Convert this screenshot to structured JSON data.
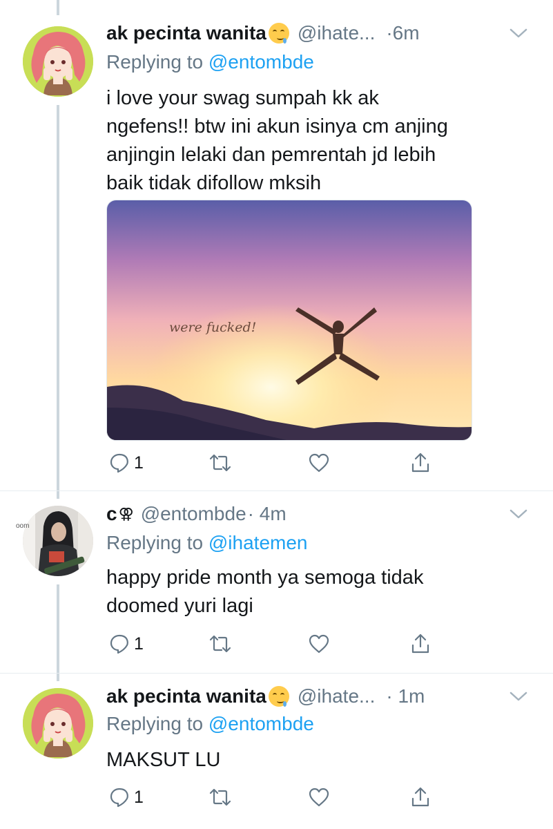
{
  "tweets": [
    {
      "name": "ak pecinta wanita",
      "handle": "@ihate...",
      "time": "·6m",
      "replying_prefix": "Replying to ",
      "replying_to": "@entombde",
      "lines": [
        "i love your swag sumpah kk ak",
        "ngefens!! btw ini akun isinya cm anjing",
        "anjingin lelaki dan pemrentah jd lebih",
        "baik tidak difollow mksih"
      ],
      "media_caption": "were fucked!",
      "reply_count": "1"
    },
    {
      "name": "c",
      "handle": "@entombde",
      "time": "· 4m",
      "replying_prefix": "Replying to ",
      "replying_to": "@ihatemen",
      "lines": [
        "happy pride month ya semoga tidak",
        "doomed yuri lagi"
      ],
      "avatar_side_text": "oom",
      "reply_count": "1"
    },
    {
      "name": "ak pecinta wanita",
      "handle": "@ihate...",
      "time": "· 1m",
      "replying_prefix": "Replying to ",
      "replying_to": "@entombde",
      "lines": [
        "MAKSUT LU"
      ],
      "reply_count": "1"
    }
  ],
  "symbols": {
    "venus_double": "⚢"
  },
  "icons": [
    "reply-icon",
    "retweet-icon",
    "like-icon",
    "share-icon",
    "chevron-down-icon",
    "drooling-face-emoji"
  ],
  "colors": {
    "link": "#1da1f2",
    "muted": "#657786",
    "thread_line": "#ccd6dd"
  }
}
